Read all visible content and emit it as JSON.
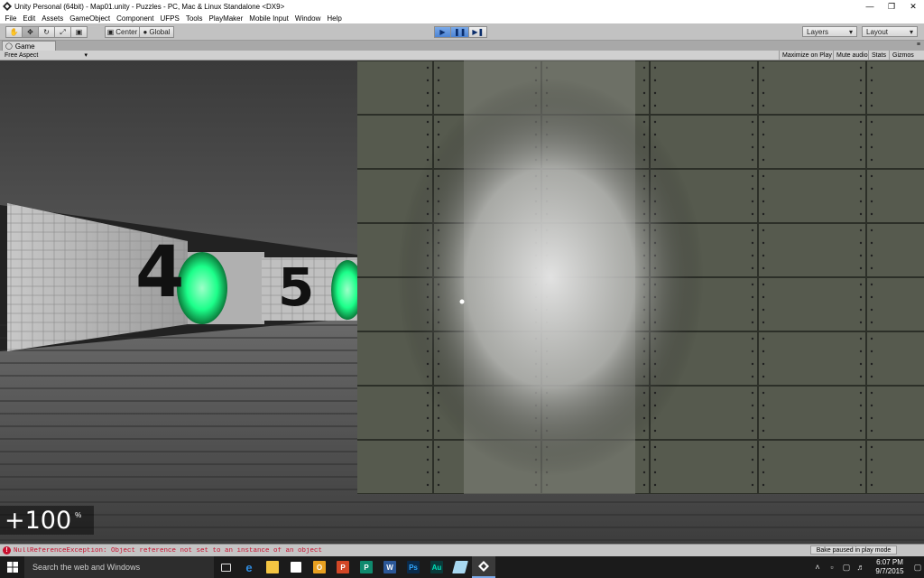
{
  "window": {
    "title": "Unity Personal (64bit) - Map01.unity - Puzzles - PC, Mac & Linux Standalone <DX9>",
    "minimize_icon": "minimize-icon",
    "maximize_icon": "restore-icon",
    "close_icon": "close-icon"
  },
  "menubar": {
    "items": [
      "File",
      "Edit",
      "Assets",
      "GameObject",
      "Component",
      "UFPS",
      "Tools",
      "PlayMaker",
      "Mobile Input",
      "Window",
      "Help"
    ]
  },
  "toolbar": {
    "transform_tools": [
      "hand-icon",
      "move-icon",
      "rotate-icon",
      "scale-icon",
      "rect-icon"
    ],
    "pivot_label": "Center",
    "space_label": "Global",
    "play_controls": [
      "play-icon",
      "pause-icon",
      "step-icon"
    ],
    "layers_label": "Layers",
    "layout_label": "Layout"
  },
  "game_tab": {
    "label": "Game",
    "aspect": "Free Aspect",
    "maximize_on_play": "Maximize on Play",
    "mute_audio": "Mute audio",
    "stats": "Stats",
    "gizmos": "Gizmos"
  },
  "scene": {
    "sign_left": "4",
    "sign_right": "5",
    "health_value": "+100",
    "health_unit": "%"
  },
  "status": {
    "error_message": "NullReferenceException: Object reference not set to an instance of an object",
    "bake_status": "Bake paused in play mode"
  },
  "taskbar": {
    "search_placeholder": "Search the web and Windows",
    "time": "6:07 PM",
    "date": "9/7/2015"
  },
  "colors": {
    "accent_play": "#4d84d4",
    "error": "#c8102e",
    "portal_green": "#1cff8a"
  }
}
